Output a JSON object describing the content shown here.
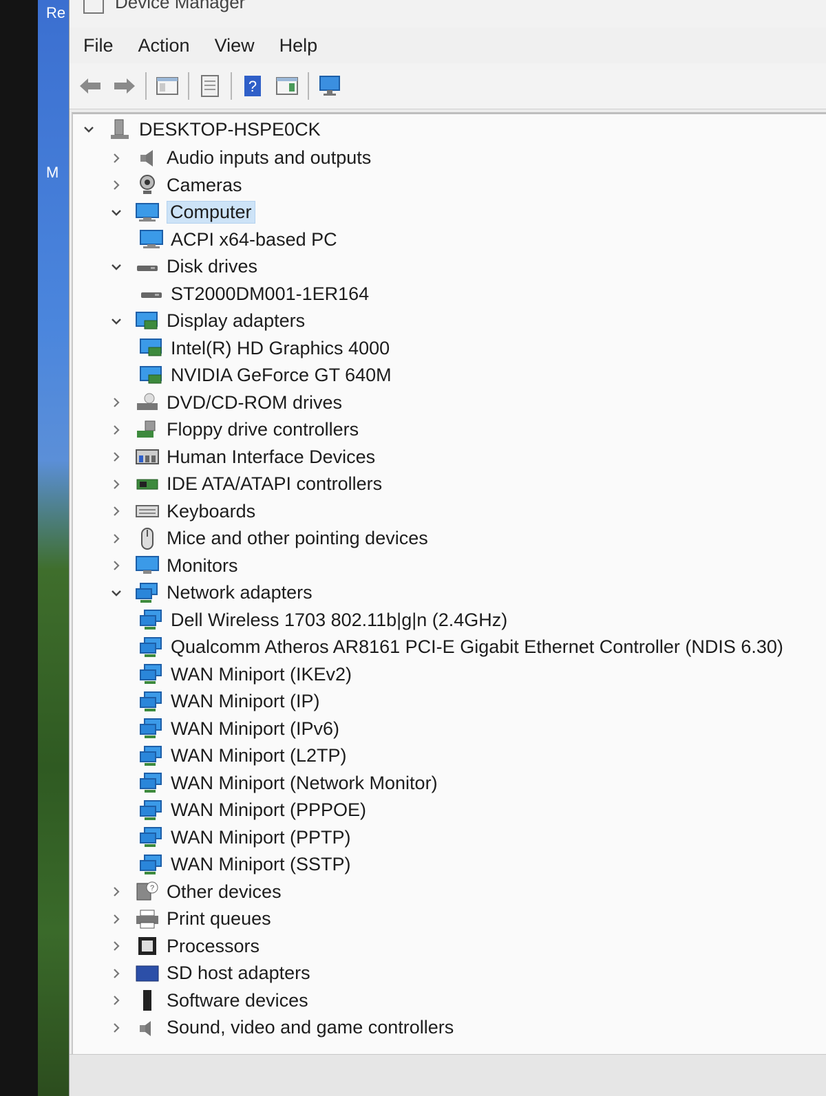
{
  "desktop": {
    "labels": [
      "Re",
      "M"
    ]
  },
  "window": {
    "title": "Device Manager"
  },
  "menu": [
    "File",
    "Action",
    "View",
    "Help"
  ],
  "toolbar": {
    "buttons": [
      "back-arrow-icon",
      "forward-arrow-icon",
      "show-hide-console-tree-icon",
      "properties-icon",
      "help-icon",
      "action-pane-icon",
      "scan-hardware-icon"
    ]
  },
  "tree": {
    "root": "DESKTOP-HSPE0CK",
    "items": [
      {
        "label": "Audio inputs and outputs",
        "level": 1,
        "expanded": false,
        "icon": "speaker-icon"
      },
      {
        "label": "Cameras",
        "level": 1,
        "expanded": false,
        "icon": "camera-icon"
      },
      {
        "label": "Computer",
        "level": 1,
        "expanded": true,
        "selected": true,
        "icon": "computer-icon"
      },
      {
        "label": "ACPI x64-based PC",
        "level": 2,
        "icon": "computer-icon"
      },
      {
        "label": "Disk drives",
        "level": 1,
        "expanded": true,
        "icon": "disk-icon"
      },
      {
        "label": "ST2000DM001-1ER164",
        "level": 2,
        "icon": "disk-icon"
      },
      {
        "label": "Display adapters",
        "level": 1,
        "expanded": true,
        "icon": "display-adapter-icon"
      },
      {
        "label": "Intel(R) HD Graphics 4000",
        "level": 2,
        "icon": "display-adapter-icon"
      },
      {
        "label": "NVIDIA GeForce GT 640M",
        "level": 2,
        "icon": "display-adapter-icon"
      },
      {
        "label": "DVD/CD-ROM drives",
        "level": 1,
        "expanded": false,
        "icon": "dvd-icon"
      },
      {
        "label": "Floppy drive controllers",
        "level": 1,
        "expanded": false,
        "icon": "floppy-controller-icon"
      },
      {
        "label": "Human Interface Devices",
        "level": 1,
        "expanded": false,
        "icon": "hid-icon"
      },
      {
        "label": "IDE ATA/ATAPI controllers",
        "level": 1,
        "expanded": false,
        "icon": "ide-controller-icon"
      },
      {
        "label": "Keyboards",
        "level": 1,
        "expanded": false,
        "icon": "keyboard-icon"
      },
      {
        "label": "Mice and other pointing devices",
        "level": 1,
        "expanded": false,
        "icon": "mouse-icon"
      },
      {
        "label": "Monitors",
        "level": 1,
        "expanded": false,
        "icon": "monitor-icon"
      },
      {
        "label": "Network adapters",
        "level": 1,
        "expanded": true,
        "icon": "network-icon"
      },
      {
        "label": "Dell Wireless 1703 802.11b|g|n (2.4GHz)",
        "level": 2,
        "icon": "network-icon"
      },
      {
        "label": "Qualcomm Atheros AR8161 PCI-E Gigabit Ethernet Controller (NDIS 6.30)",
        "level": 2,
        "icon": "network-icon"
      },
      {
        "label": "WAN Miniport (IKEv2)",
        "level": 2,
        "icon": "network-icon"
      },
      {
        "label": "WAN Miniport (IP)",
        "level": 2,
        "icon": "network-icon"
      },
      {
        "label": "WAN Miniport (IPv6)",
        "level": 2,
        "icon": "network-icon"
      },
      {
        "label": "WAN Miniport (L2TP)",
        "level": 2,
        "icon": "network-icon"
      },
      {
        "label": "WAN Miniport (Network Monitor)",
        "level": 2,
        "icon": "network-icon"
      },
      {
        "label": "WAN Miniport (PPPOE)",
        "level": 2,
        "icon": "network-icon"
      },
      {
        "label": "WAN Miniport (PPTP)",
        "level": 2,
        "icon": "network-icon"
      },
      {
        "label": "WAN Miniport (SSTP)",
        "level": 2,
        "icon": "network-icon"
      },
      {
        "label": "Other devices",
        "level": 1,
        "expanded": false,
        "icon": "unknown-device-icon"
      },
      {
        "label": "Print queues",
        "level": 1,
        "expanded": false,
        "icon": "printer-icon"
      },
      {
        "label": "Processors",
        "level": 1,
        "expanded": false,
        "icon": "processor-icon"
      },
      {
        "label": "SD host adapters",
        "level": 1,
        "expanded": false,
        "icon": "sd-host-icon"
      },
      {
        "label": "Software devices",
        "level": 1,
        "expanded": false,
        "icon": "software-device-icon"
      },
      {
        "label": "Sound, video and game controllers",
        "level": 1,
        "expanded": false,
        "icon": "sound-icon"
      }
    ]
  },
  "colors": {
    "selection": "#cde3f7",
    "network_blue": "#1e88e5",
    "window_bg": "#ececec"
  }
}
